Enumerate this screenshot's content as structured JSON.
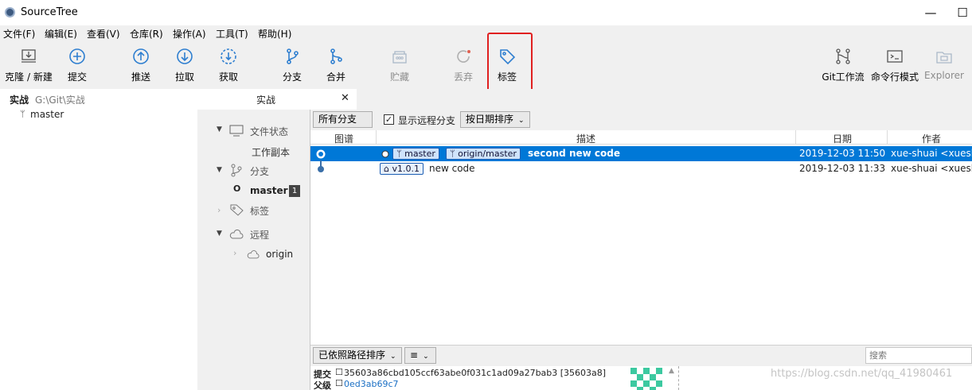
{
  "window": {
    "title": "SourceTree",
    "minimize": "—",
    "maximize": "☐"
  },
  "menu": [
    "文件(F)",
    "编辑(E)",
    "查看(V)",
    "仓库(R)",
    "操作(A)",
    "工具(T)",
    "帮助(H)"
  ],
  "toolbar": {
    "clone": "克隆 / 新建",
    "commit": "提交",
    "push": "推送",
    "pull": "拉取",
    "fetch": "获取",
    "branch": "分支",
    "merge": "合并",
    "stash": "贮藏",
    "discard": "丢弃",
    "tag": "标签",
    "gitflow": "Git工作流",
    "terminal": "命令行模式",
    "explorer": "Explorer"
  },
  "repo_list": {
    "name": "实战",
    "path": "G:\\Git\\实战",
    "branch": "master"
  },
  "tab": {
    "label": "实战",
    "close": "✕"
  },
  "nav": {
    "file_status": "文件状态",
    "working_copy": "工作副本",
    "branches": "分支",
    "master": "master",
    "tags": "标签",
    "remotes": "远程",
    "origin": "origin"
  },
  "filters": {
    "all_branches": "所有分支",
    "show_remote": "显示远程分支",
    "sort": "按日期排序"
  },
  "columns": {
    "graph": "图谱",
    "description": "描述",
    "date": "日期",
    "author": "作者"
  },
  "commits": [
    {
      "branch_local": "master",
      "branch_remote": "origin/master",
      "message": "second new code",
      "date": "2019-12-03 11:50",
      "author": "xue-shuai <xuesh"
    },
    {
      "tag": "v1.0.1",
      "message": "new code",
      "date": "2019-12-03 11:33",
      "author": "xue-shuai <xuesh"
    }
  ],
  "bottom": {
    "sort_by_path": "已依照路径排序",
    "list_icon": "≡",
    "search_placeholder": "搜索"
  },
  "details": {
    "commit_label": "提交",
    "commit_hash": "35603a86cbd105ccf63abe0f031c1ad09a27bab3 [35603a8]",
    "parent_label": "父级",
    "parent_hash": "0ed3ab69c7"
  },
  "watermark": "https://blog.csdn.net/qq_41980461"
}
